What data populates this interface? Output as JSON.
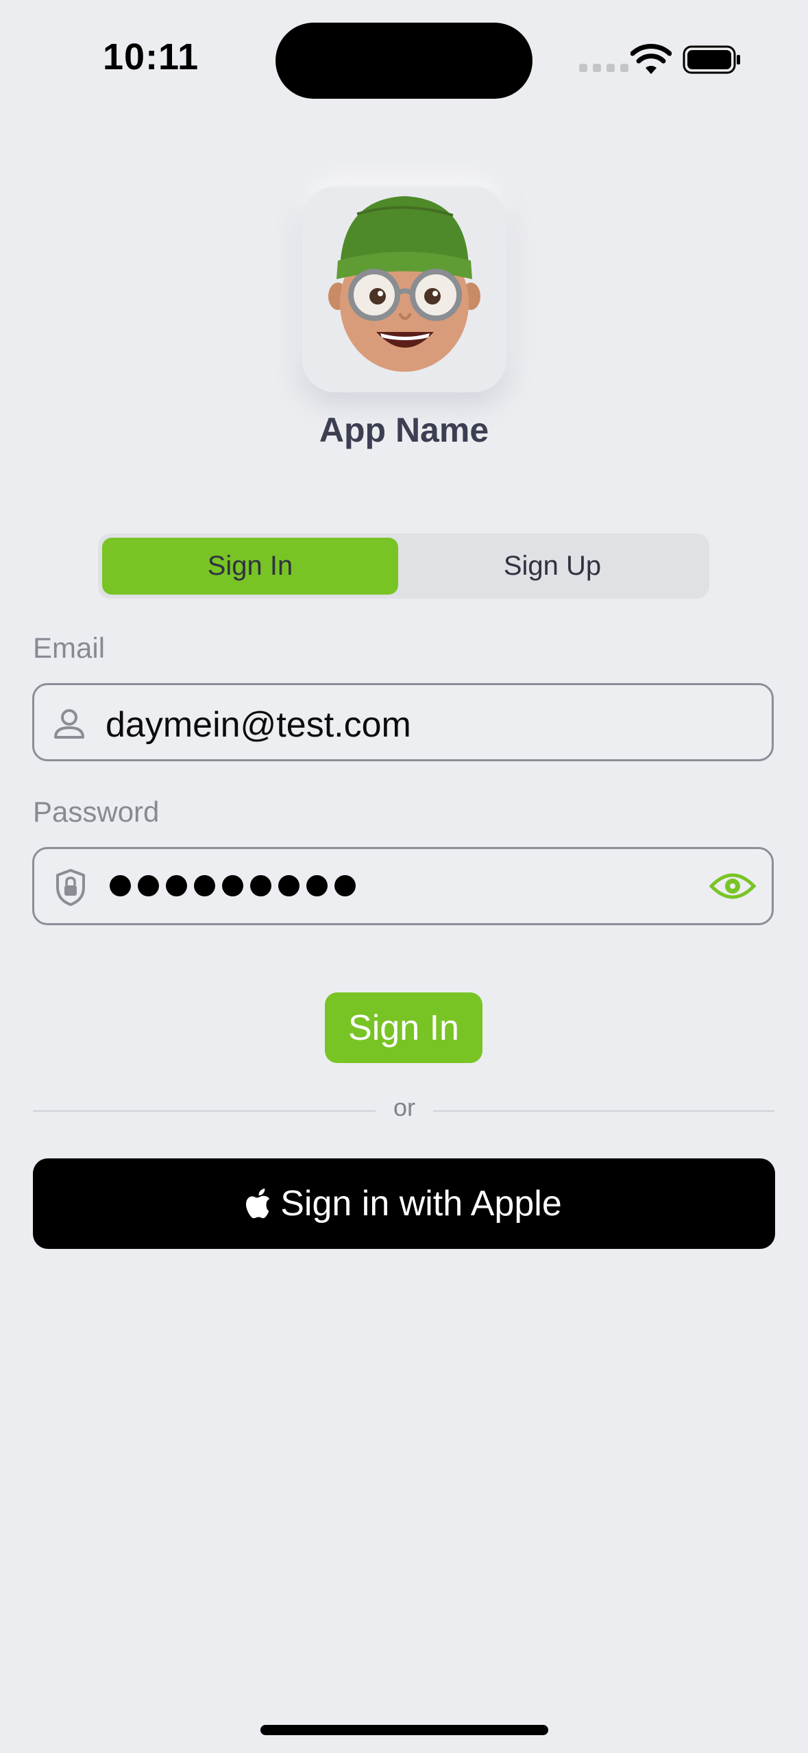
{
  "status_bar": {
    "time": "10:11"
  },
  "app": {
    "name": "App Name"
  },
  "auth_tabs": {
    "sign_in": "Sign In",
    "sign_up": "Sign Up",
    "selected": "Sign In"
  },
  "form": {
    "email_label": "Email",
    "email_value": "daymein@test.com",
    "password_label": "Password",
    "password_masked_length": 9
  },
  "actions": {
    "sign_in_button": "Sign In",
    "divider_text": "or",
    "apple_button": "Sign in with Apple"
  },
  "colors": {
    "accent": "#79c425",
    "background": "#ecedf0"
  },
  "icons": [
    "person-icon",
    "shield-lock-icon",
    "eye-icon",
    "apple-logo-icon",
    "wifi-icon",
    "battery-icon"
  ]
}
